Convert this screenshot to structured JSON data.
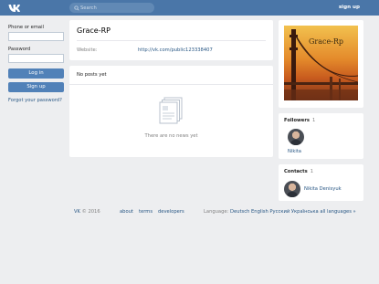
{
  "topbar": {
    "search_placeholder": "Search",
    "signup_label": "sign up"
  },
  "login": {
    "phone_label": "Phone or email",
    "password_label": "Password",
    "login_button": "Log in",
    "signup_button": "Sign up",
    "forgot_link": "Forgot your password?"
  },
  "page": {
    "title": "Grace-RP",
    "website_label": "Website:",
    "website_value": "http://vk.com/public123338407"
  },
  "posts": {
    "header": "No posts yet",
    "empty_text": "There are no news yet"
  },
  "cover": {
    "photo_text": "Grace-Rp"
  },
  "followers": {
    "label": "Followers",
    "count": "1",
    "people": [
      {
        "name": "Nikita"
      }
    ]
  },
  "contacts": {
    "label": "Contacts",
    "count": "1",
    "people": [
      {
        "name": "Nikita Denisyuk"
      }
    ]
  },
  "footer": {
    "brand": "VK",
    "copyright": "© 2016",
    "links": [
      "about",
      "terms",
      "developers"
    ],
    "language_label": "Language:",
    "languages": [
      "Deutsch",
      "English",
      "Русский",
      "Українська",
      "all languages »"
    ]
  },
  "colors": {
    "header_bg": "#4a76a8",
    "link": "#2a5885",
    "button": "#5181b8",
    "page_bg": "#edeef0"
  }
}
